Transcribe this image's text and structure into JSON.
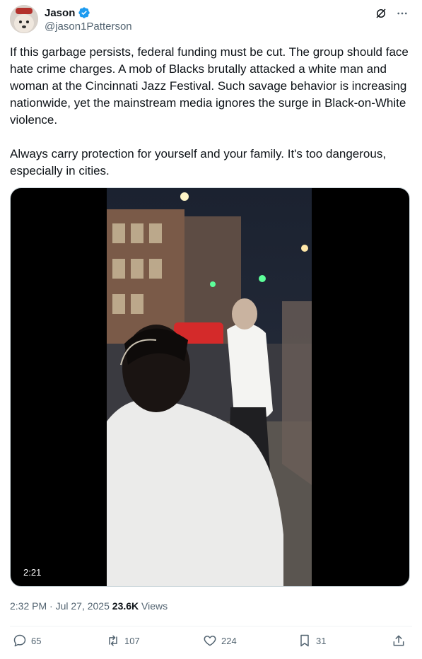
{
  "author": {
    "display_name": "Jason",
    "handle": "@jason1Patterson",
    "verified": true
  },
  "icons": {
    "grok": "grok-icon",
    "more": "more-icon",
    "reply": "reply-icon",
    "repost": "repost-icon",
    "like": "heart-icon",
    "bookmark": "bookmark-icon",
    "share": "share-icon"
  },
  "post": {
    "text": "If this garbage persists, federal funding must be cut. The group should face hate crime charges. A mob of Blacks brutally attacked a white man and woman at the Cincinnati Jazz Festival. Such savage behavior is increasing nationwide, yet the mainstream media ignores the surge in Black-on-White violence.\n\nAlways carry protection for yourself and your family. It's too dangerous, especially in cities.",
    "video_duration": "2:21"
  },
  "meta": {
    "time": "2:32 PM",
    "separator": " · ",
    "date": "Jul 27, 2025",
    "views_count": "23.6K",
    "views_label": " Views"
  },
  "actions": {
    "replies": "65",
    "reposts": "107",
    "likes": "224",
    "bookmarks": "31"
  },
  "colors": {
    "verified": "#1d9bf0",
    "secondary_text": "#536471",
    "primary_text": "#0f1419"
  }
}
